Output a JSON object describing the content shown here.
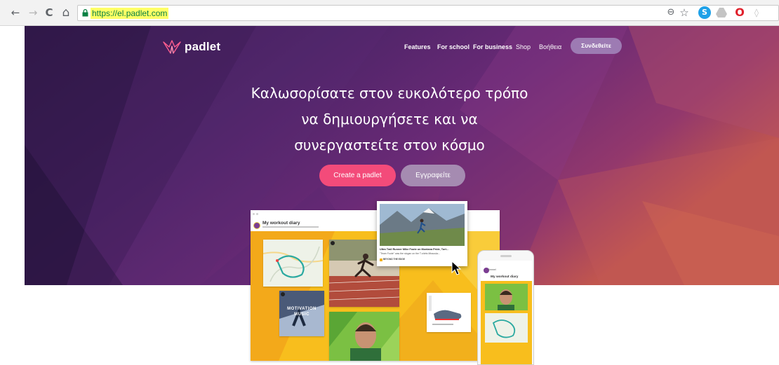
{
  "browser": {
    "url": "https://el.padlet.com",
    "back_glyph": "←",
    "forward_glyph": "→",
    "reload_glyph": "C",
    "home_glyph": "⌂",
    "zoom_glyph": "⊖",
    "star_glyph": "☆",
    "ext_skype": "S",
    "ext_opera": "O",
    "ext_other": "◊"
  },
  "header": {
    "logo_text": "padlet",
    "nav": [
      {
        "label": "Features"
      },
      {
        "label": "For school"
      },
      {
        "label": "For business"
      },
      {
        "label": "Shop"
      },
      {
        "label": "Βοήθεια"
      }
    ],
    "login_label": "Συνδεθείτε"
  },
  "hero": {
    "headline_lines": [
      "Καλωσορίσατε στον ευκολότερο τρόπο",
      "να δημιουργήσετε και να",
      "συνεργαστείτε στον κόσμο"
    ],
    "primary_cta": "Create a padlet",
    "secondary_cta": "Εγγραφείτε"
  },
  "showcase": {
    "board_title": "My workout diary",
    "motivation_text": "MOTIVATION MUSIC",
    "trail_title": "Ultra Trail Runner Mike Foote on Montana Pride, Turt...",
    "trail_desc": "\"Team Foote\" was the slogan on the T-shirts Missoula...",
    "trail_source": "BEYOND THE EDGE",
    "phone_user": "Kimmel",
    "phone_board_title": "My workout diary"
  },
  "colors": {
    "hero_deep": "#3a1d56",
    "hero_mid": "#6b2b77",
    "hero_warm": "#c1564e",
    "cta_pink": "#f34b7a",
    "cta_lilac": "#a58bb1",
    "board_yellow": "#f8be1d",
    "url_highlight": "#ffff66"
  }
}
